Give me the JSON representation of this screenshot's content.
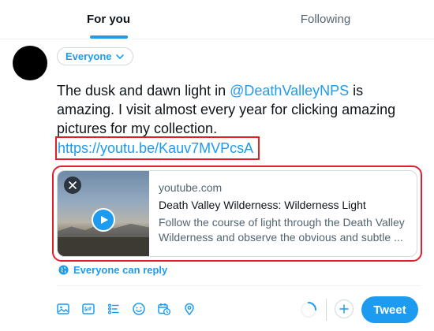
{
  "tabs": [
    {
      "label": "For you",
      "active": true
    },
    {
      "label": "Following",
      "active": false
    }
  ],
  "audience": {
    "label": "Everyone",
    "icon": "chevron-down-icon"
  },
  "compose": {
    "text_before": "The dusk and dawn light in ",
    "mention": "@DeathValleyNPS",
    "text_after": " is amazing. I visit almost every year for clicking amazing pictures for my collection.",
    "link": "https://youtu.be/Kauv7MVPcsA"
  },
  "card": {
    "domain": "youtube.com",
    "title": "Death Valley Wilderness: Wilderness Light",
    "description": "Follow the course of light through the Death Valley Wilderness and observe the obvious and subtle ..."
  },
  "reply_setting": {
    "label": "Everyone can reply",
    "icon": "globe-icon"
  },
  "toolbar": {
    "icons": [
      "image-icon",
      "gif-icon",
      "poll-icon",
      "emoji-icon",
      "schedule-icon",
      "location-icon"
    ]
  },
  "actions": {
    "tweet_label": "Tweet"
  },
  "colors": {
    "accent": "#1d9bf0",
    "highlight_border": "#e0202a",
    "text": "#0f1419",
    "muted": "#536471"
  }
}
